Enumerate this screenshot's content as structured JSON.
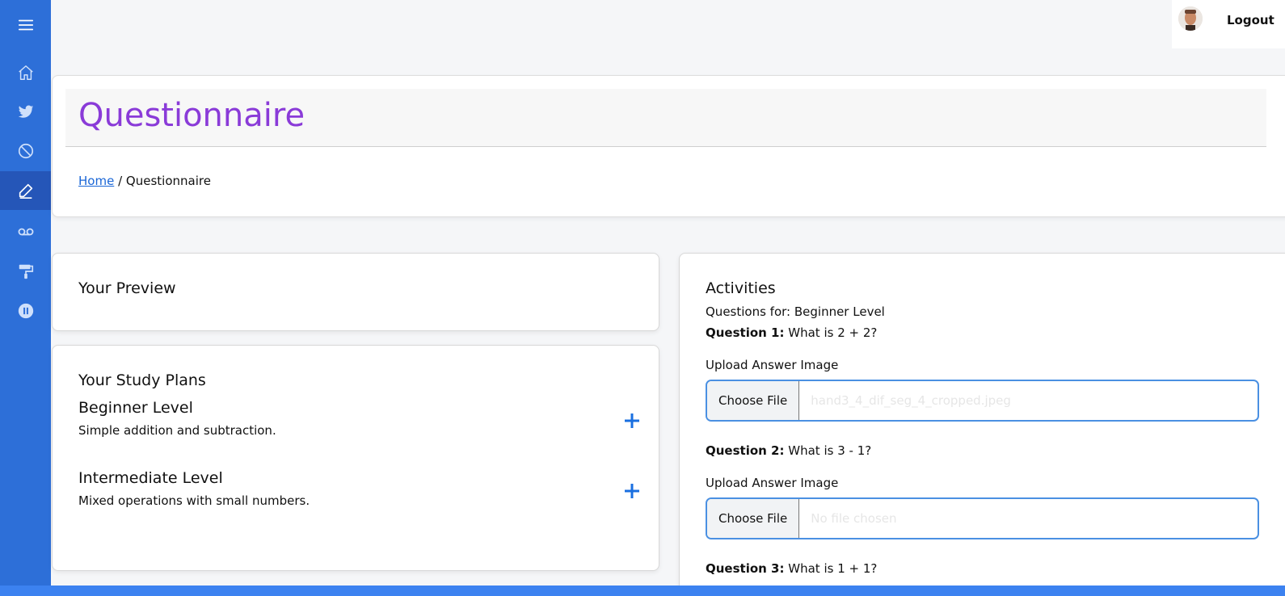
{
  "sidebar": {
    "items": [
      {
        "name": "menu-icon"
      },
      {
        "name": "home-icon"
      },
      {
        "name": "twitter-icon"
      },
      {
        "name": "ban-icon"
      },
      {
        "name": "pencil-icon"
      },
      {
        "name": "voicemail-icon"
      },
      {
        "name": "paint-roller-icon"
      },
      {
        "name": "pause-circle-icon"
      }
    ],
    "active": "pencil-icon",
    "color": "#2d6fd8"
  },
  "user": {
    "logout_label": "Logout"
  },
  "header": {
    "title": "Questionnaire",
    "title_color": "#8a3bd8",
    "breadcrumb_home": "Home",
    "breadcrumb_separator": "/",
    "breadcrumb_current": "Questionnaire"
  },
  "preview": {
    "title": "Your Preview"
  },
  "study_plans": {
    "title": "Your Study Plans",
    "plans": [
      {
        "name": "Beginner Level",
        "description": "Simple addition and subtraction."
      },
      {
        "name": "Intermediate Level",
        "description": "Mixed operations with small numbers."
      }
    ]
  },
  "activities": {
    "title": "Activities",
    "subtitle": "Questions for: Beginner Level",
    "questions": [
      {
        "label": "Question 1:",
        "text": "What is 2 + 2?",
        "upload_label": "Upload Answer Image",
        "button": "Choose File",
        "file": "hand3_4_dif_seg_4_cropped.jpeg"
      },
      {
        "label": "Question 2:",
        "text": "What is 3 - 1?",
        "upload_label": "Upload Answer Image",
        "button": "Choose File",
        "file": "No file chosen"
      },
      {
        "label": "Question 3:",
        "text": "What is 1 + 1?"
      }
    ]
  }
}
